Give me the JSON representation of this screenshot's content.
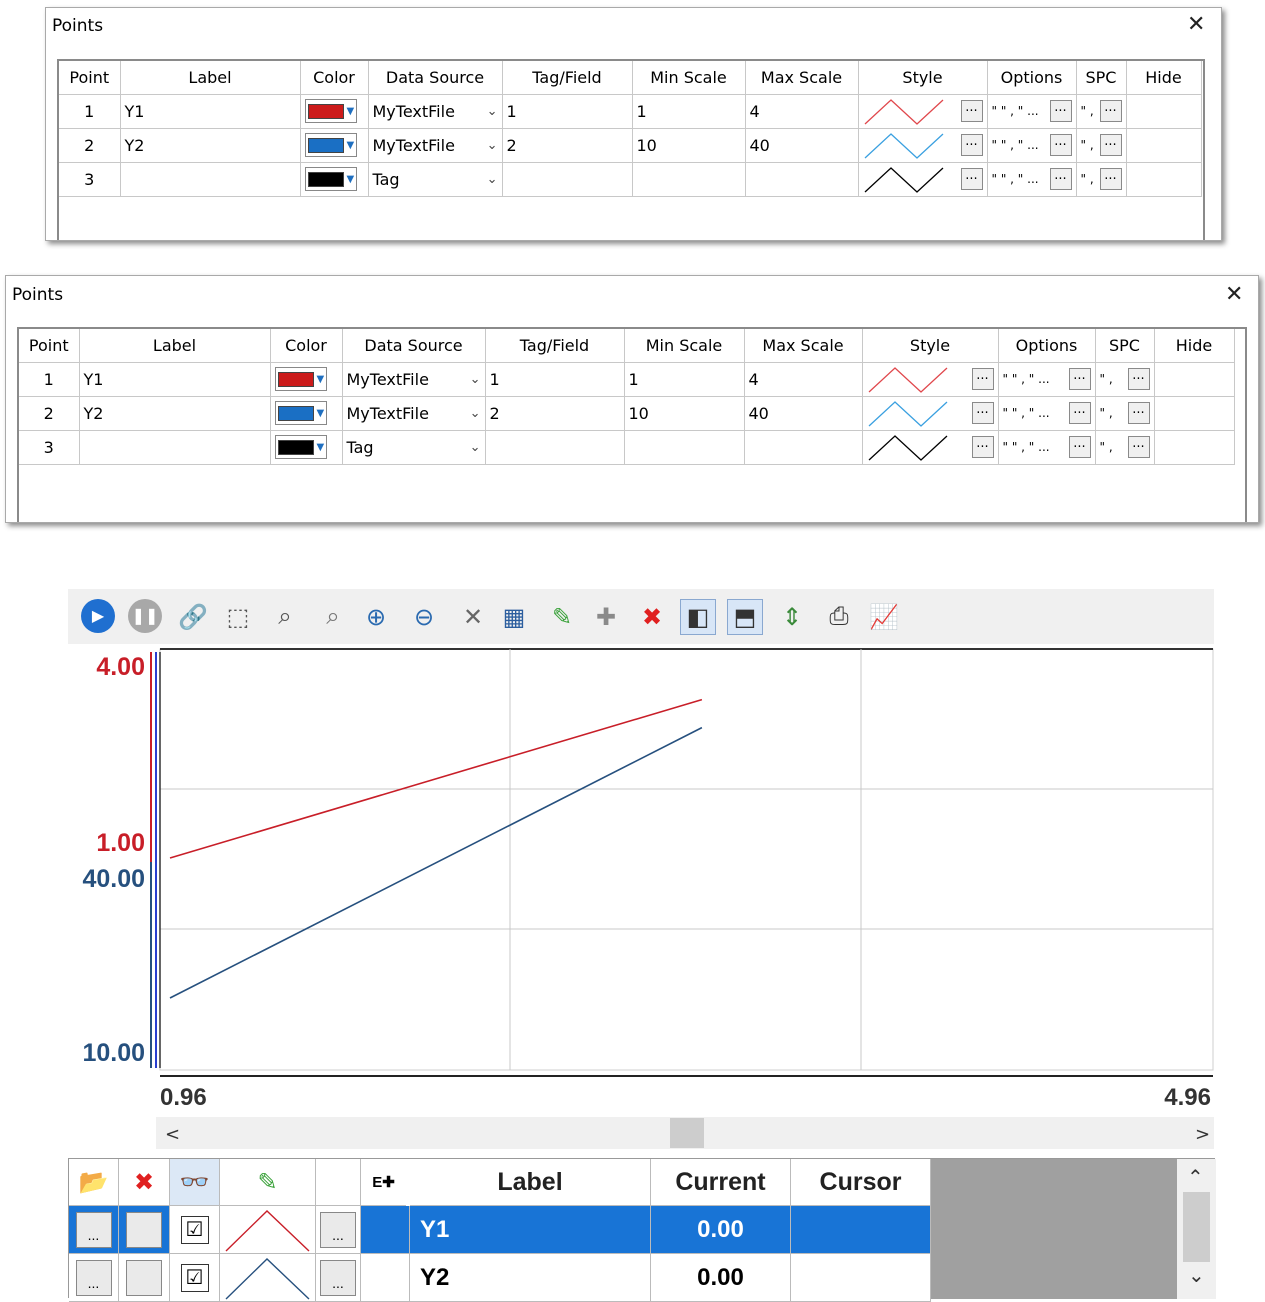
{
  "dialog": {
    "title": "Points",
    "close_icon": "close-icon",
    "columns": [
      "Point",
      "Label",
      "Color",
      "Data Source",
      "Tag/Field",
      "Min Scale",
      "Max Scale",
      "Style",
      "Options",
      "SPC",
      "Hide"
    ],
    "rows": [
      {
        "point": "1",
        "label": "Y1",
        "color": "#cc1b1b",
        "source": "MyTextFile",
        "tag": "1",
        "min": "1",
        "max": "4",
        "style_color": "#e0474c"
      },
      {
        "point": "2",
        "label": "Y2",
        "color": "#1a6fc4",
        "source": "MyTextFile",
        "tag": "2",
        "min": "10",
        "max": "40",
        "style_color": "#3aa0e0"
      },
      {
        "point": "3",
        "label": "",
        "color": "#000000",
        "source": "Tag",
        "tag": "",
        "min": "",
        "max": "",
        "style_color": "#000000"
      }
    ],
    "options_text": "\" \" , \" ...",
    "spc_text": "\" ,",
    "button_dots": "..."
  },
  "toolbar": {
    "icons": [
      "play-icon",
      "pause-icon",
      "link-icon",
      "zoom-box-icon",
      "zoom-x-icon",
      "zoom-y-icon",
      "zoom-in-icon",
      "zoom-out-icon",
      "zoom-reset-icon",
      "table-icon",
      "highlight-pen-icon",
      "add-icon",
      "delete-icon",
      "split-left-icon",
      "split-top-icon",
      "fit-vertical-icon",
      "print-icon",
      "chart-settings-icon"
    ]
  },
  "chart_data": {
    "type": "line",
    "series": [
      {
        "name": "Y1",
        "color": "#c81e28",
        "x": [
          0.96,
          3.0
        ],
        "y": [
          1.0,
          3.4
        ],
        "ylim": [
          1.0,
          4.0
        ]
      },
      {
        "name": "Y2",
        "color": "#26507e",
        "x": [
          0.96,
          3.0
        ],
        "y": [
          10.0,
          34.0
        ],
        "ylim": [
          10.0,
          40.0
        ]
      }
    ],
    "xlim": [
      0.96,
      4.96
    ],
    "x_tick_labels": [
      "0.96",
      "4.96"
    ],
    "y_axes": [
      {
        "color": "#c81e28",
        "labels": [
          "4.00",
          "1.00"
        ]
      },
      {
        "color": "#26507e",
        "labels": [
          "40.00",
          "10.00"
        ]
      }
    ],
    "grid": true
  },
  "scrollbar": {
    "left_icon": "<",
    "right_icon": ">"
  },
  "legend": {
    "header_icons": [
      "open-folder-icon",
      "delete-x-icon",
      "glasses-icon",
      "pen-icon",
      "add-column-icon"
    ],
    "columns": [
      "Label",
      "Current",
      "Cursor"
    ],
    "rows": [
      {
        "label": "Y1",
        "current": "0.00",
        "cursor": "",
        "selected": true,
        "line_color": "#c81e28"
      },
      {
        "label": "Y2",
        "current": "0.00",
        "cursor": "",
        "selected": false,
        "line_color": "#26507e"
      }
    ],
    "button_dots": "...",
    "check_mark": "☑"
  }
}
